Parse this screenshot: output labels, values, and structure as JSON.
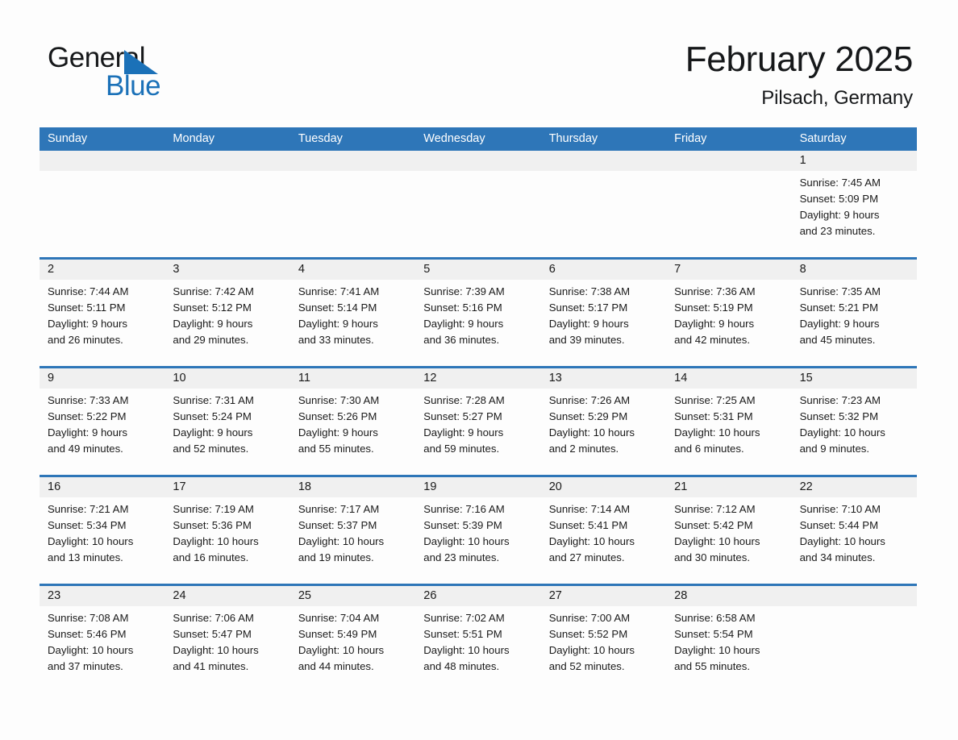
{
  "brand": {
    "name_part1": "General",
    "name_part2": "Blue",
    "triangle_color": "#1b71b8"
  },
  "header": {
    "title": "February 2025",
    "subtitle": "Pilsach, Germany"
  },
  "theme": {
    "header_blue": "#2e76b8",
    "band_gray": "#f0f0f0",
    "page_bg": "#fdfdfd"
  },
  "weekdays": [
    "Sunday",
    "Monday",
    "Tuesday",
    "Wednesday",
    "Thursday",
    "Friday",
    "Saturday"
  ],
  "weeks": [
    [
      {
        "date": "",
        "empty": true
      },
      {
        "date": "",
        "empty": true
      },
      {
        "date": "",
        "empty": true
      },
      {
        "date": "",
        "empty": true
      },
      {
        "date": "",
        "empty": true
      },
      {
        "date": "",
        "empty": true
      },
      {
        "date": "1",
        "sunrise": "Sunrise: 7:45 AM",
        "sunset": "Sunset: 5:09 PM",
        "daylight1": "Daylight: 9 hours",
        "daylight2": "and 23 minutes."
      }
    ],
    [
      {
        "date": "2",
        "sunrise": "Sunrise: 7:44 AM",
        "sunset": "Sunset: 5:11 PM",
        "daylight1": "Daylight: 9 hours",
        "daylight2": "and 26 minutes."
      },
      {
        "date": "3",
        "sunrise": "Sunrise: 7:42 AM",
        "sunset": "Sunset: 5:12 PM",
        "daylight1": "Daylight: 9 hours",
        "daylight2": "and 29 minutes."
      },
      {
        "date": "4",
        "sunrise": "Sunrise: 7:41 AM",
        "sunset": "Sunset: 5:14 PM",
        "daylight1": "Daylight: 9 hours",
        "daylight2": "and 33 minutes."
      },
      {
        "date": "5",
        "sunrise": "Sunrise: 7:39 AM",
        "sunset": "Sunset: 5:16 PM",
        "daylight1": "Daylight: 9 hours",
        "daylight2": "and 36 minutes."
      },
      {
        "date": "6",
        "sunrise": "Sunrise: 7:38 AM",
        "sunset": "Sunset: 5:17 PM",
        "daylight1": "Daylight: 9 hours",
        "daylight2": "and 39 minutes."
      },
      {
        "date": "7",
        "sunrise": "Sunrise: 7:36 AM",
        "sunset": "Sunset: 5:19 PM",
        "daylight1": "Daylight: 9 hours",
        "daylight2": "and 42 minutes."
      },
      {
        "date": "8",
        "sunrise": "Sunrise: 7:35 AM",
        "sunset": "Sunset: 5:21 PM",
        "daylight1": "Daylight: 9 hours",
        "daylight2": "and 45 minutes."
      }
    ],
    [
      {
        "date": "9",
        "sunrise": "Sunrise: 7:33 AM",
        "sunset": "Sunset: 5:22 PM",
        "daylight1": "Daylight: 9 hours",
        "daylight2": "and 49 minutes."
      },
      {
        "date": "10",
        "sunrise": "Sunrise: 7:31 AM",
        "sunset": "Sunset: 5:24 PM",
        "daylight1": "Daylight: 9 hours",
        "daylight2": "and 52 minutes."
      },
      {
        "date": "11",
        "sunrise": "Sunrise: 7:30 AM",
        "sunset": "Sunset: 5:26 PM",
        "daylight1": "Daylight: 9 hours",
        "daylight2": "and 55 minutes."
      },
      {
        "date": "12",
        "sunrise": "Sunrise: 7:28 AM",
        "sunset": "Sunset: 5:27 PM",
        "daylight1": "Daylight: 9 hours",
        "daylight2": "and 59 minutes."
      },
      {
        "date": "13",
        "sunrise": "Sunrise: 7:26 AM",
        "sunset": "Sunset: 5:29 PM",
        "daylight1": "Daylight: 10 hours",
        "daylight2": "and 2 minutes."
      },
      {
        "date": "14",
        "sunrise": "Sunrise: 7:25 AM",
        "sunset": "Sunset: 5:31 PM",
        "daylight1": "Daylight: 10 hours",
        "daylight2": "and 6 minutes."
      },
      {
        "date": "15",
        "sunrise": "Sunrise: 7:23 AM",
        "sunset": "Sunset: 5:32 PM",
        "daylight1": "Daylight: 10 hours",
        "daylight2": "and 9 minutes."
      }
    ],
    [
      {
        "date": "16",
        "sunrise": "Sunrise: 7:21 AM",
        "sunset": "Sunset: 5:34 PM",
        "daylight1": "Daylight: 10 hours",
        "daylight2": "and 13 minutes."
      },
      {
        "date": "17",
        "sunrise": "Sunrise: 7:19 AM",
        "sunset": "Sunset: 5:36 PM",
        "daylight1": "Daylight: 10 hours",
        "daylight2": "and 16 minutes."
      },
      {
        "date": "18",
        "sunrise": "Sunrise: 7:17 AM",
        "sunset": "Sunset: 5:37 PM",
        "daylight1": "Daylight: 10 hours",
        "daylight2": "and 19 minutes."
      },
      {
        "date": "19",
        "sunrise": "Sunrise: 7:16 AM",
        "sunset": "Sunset: 5:39 PM",
        "daylight1": "Daylight: 10 hours",
        "daylight2": "and 23 minutes."
      },
      {
        "date": "20",
        "sunrise": "Sunrise: 7:14 AM",
        "sunset": "Sunset: 5:41 PM",
        "daylight1": "Daylight: 10 hours",
        "daylight2": "and 27 minutes."
      },
      {
        "date": "21",
        "sunrise": "Sunrise: 7:12 AM",
        "sunset": "Sunset: 5:42 PM",
        "daylight1": "Daylight: 10 hours",
        "daylight2": "and 30 minutes."
      },
      {
        "date": "22",
        "sunrise": "Sunrise: 7:10 AM",
        "sunset": "Sunset: 5:44 PM",
        "daylight1": "Daylight: 10 hours",
        "daylight2": "and 34 minutes."
      }
    ],
    [
      {
        "date": "23",
        "sunrise": "Sunrise: 7:08 AM",
        "sunset": "Sunset: 5:46 PM",
        "daylight1": "Daylight: 10 hours",
        "daylight2": "and 37 minutes."
      },
      {
        "date": "24",
        "sunrise": "Sunrise: 7:06 AM",
        "sunset": "Sunset: 5:47 PM",
        "daylight1": "Daylight: 10 hours",
        "daylight2": "and 41 minutes."
      },
      {
        "date": "25",
        "sunrise": "Sunrise: 7:04 AM",
        "sunset": "Sunset: 5:49 PM",
        "daylight1": "Daylight: 10 hours",
        "daylight2": "and 44 minutes."
      },
      {
        "date": "26",
        "sunrise": "Sunrise: 7:02 AM",
        "sunset": "Sunset: 5:51 PM",
        "daylight1": "Daylight: 10 hours",
        "daylight2": "and 48 minutes."
      },
      {
        "date": "27",
        "sunrise": "Sunrise: 7:00 AM",
        "sunset": "Sunset: 5:52 PM",
        "daylight1": "Daylight: 10 hours",
        "daylight2": "and 52 minutes."
      },
      {
        "date": "28",
        "sunrise": "Sunrise: 6:58 AM",
        "sunset": "Sunset: 5:54 PM",
        "daylight1": "Daylight: 10 hours",
        "daylight2": "and 55 minutes."
      },
      {
        "date": "",
        "empty": true
      }
    ]
  ]
}
